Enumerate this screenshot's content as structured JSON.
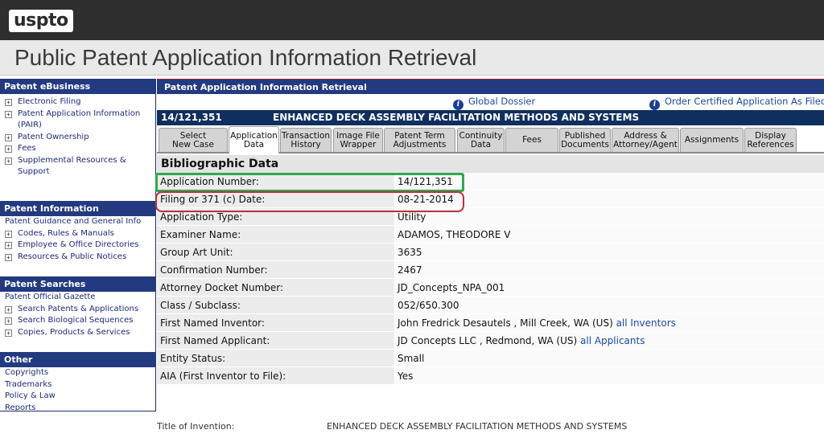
{
  "brand": {
    "logo": "uspto",
    "page_title": "Public Patent Application Information Retrieval"
  },
  "sidebar": {
    "sections": [
      {
        "title": "Patent eBusiness",
        "items": [
          {
            "label": "Electronic Filing",
            "expandable": true
          },
          {
            "label": "Patent Application Information (PAIR)",
            "expandable": true
          },
          {
            "label": "Patent Ownership",
            "expandable": true
          },
          {
            "label": "Fees",
            "expandable": true
          },
          {
            "label": "Supplemental Resources & Support",
            "expandable": true
          }
        ]
      },
      {
        "title": "Patent Information",
        "items": [
          {
            "label": "Patent Guidance and General Info",
            "expandable": false
          },
          {
            "label": "Codes, Rules & Manuals",
            "expandable": true
          },
          {
            "label": "Employee & Office Directories",
            "expandable": true
          },
          {
            "label": "Resources & Public Notices",
            "expandable": true
          }
        ]
      },
      {
        "title": "Patent Searches",
        "items": [
          {
            "label": "Patent Official Gazette",
            "expandable": false
          },
          {
            "label": "Search Patents & Applications",
            "expandable": true
          },
          {
            "label": "Search Biological Sequences",
            "expandable": true
          },
          {
            "label": "Copies, Products & Services",
            "expandable": true
          }
        ]
      },
      {
        "title": "Other",
        "items": [
          {
            "label": "Copyrights",
            "expandable": false
          },
          {
            "label": "Trademarks",
            "expandable": false
          },
          {
            "label": "Policy & Law",
            "expandable": false
          },
          {
            "label": "Reports",
            "expandable": false
          }
        ]
      }
    ]
  },
  "main": {
    "header": "Patent Application Information Retrieval",
    "links": {
      "global_dossier": "Global Dossier",
      "order_certified": "Order Certified Application As Filed"
    },
    "application": {
      "number": "14/121,351",
      "title": "ENHANCED DECK ASSEMBLY FACILITATION METHODS AND SYSTEMS"
    },
    "tabs": [
      "Select\nNew Case",
      "Application\nData",
      "Transaction\nHistory",
      "Image File\nWrapper",
      "Patent Term\nAdjustments",
      "Continuity\nData",
      "Fees",
      "Published\nDocuments",
      "Address &\nAttorney/Agent",
      "Assignments",
      "Display\nReferences"
    ],
    "active_tab": "Application\nData",
    "section_title": "Bibliographic Data",
    "fields": [
      {
        "label": "Application Number:",
        "value": "14/121,351"
      },
      {
        "label": "Filing or 371 (c) Date:",
        "value": "08-21-2014"
      },
      {
        "label": "Application Type:",
        "value": "Utility"
      },
      {
        "label": "Examiner Name:",
        "value": "ADAMOS, THEODORE V"
      },
      {
        "label": "Group Art Unit:",
        "value": "3635"
      },
      {
        "label": "Confirmation Number:",
        "value": "2467"
      },
      {
        "label": "Attorney Docket Number:",
        "value": "JD_Concepts_NPA_001"
      },
      {
        "label": "Class / Subclass:",
        "value": "052/650.300"
      },
      {
        "label": "First Named Inventor:",
        "value": "John Fredrick Desautels , Mill Creek, WA (US)",
        "link": "all Inventors"
      },
      {
        "label": "First Named Applicant:",
        "value": "JD Concepts LLC , Redmond, WA (US)",
        "link": "all Applicants"
      },
      {
        "label": "Entity Status:",
        "value": "Small"
      },
      {
        "label": "AIA (First Inventor to File):",
        "value": "Yes"
      }
    ],
    "title_of_invention": {
      "label": "Title of Invention:",
      "value": "ENHANCED DECK ASSEMBLY FACILITATION METHODS AND SYSTEMS"
    }
  },
  "colors": {
    "nav_blue": "#233a80",
    "app_header": "#0f2f5e",
    "highlight_green": "#2fa84f",
    "highlight_red": "#b7323b"
  }
}
